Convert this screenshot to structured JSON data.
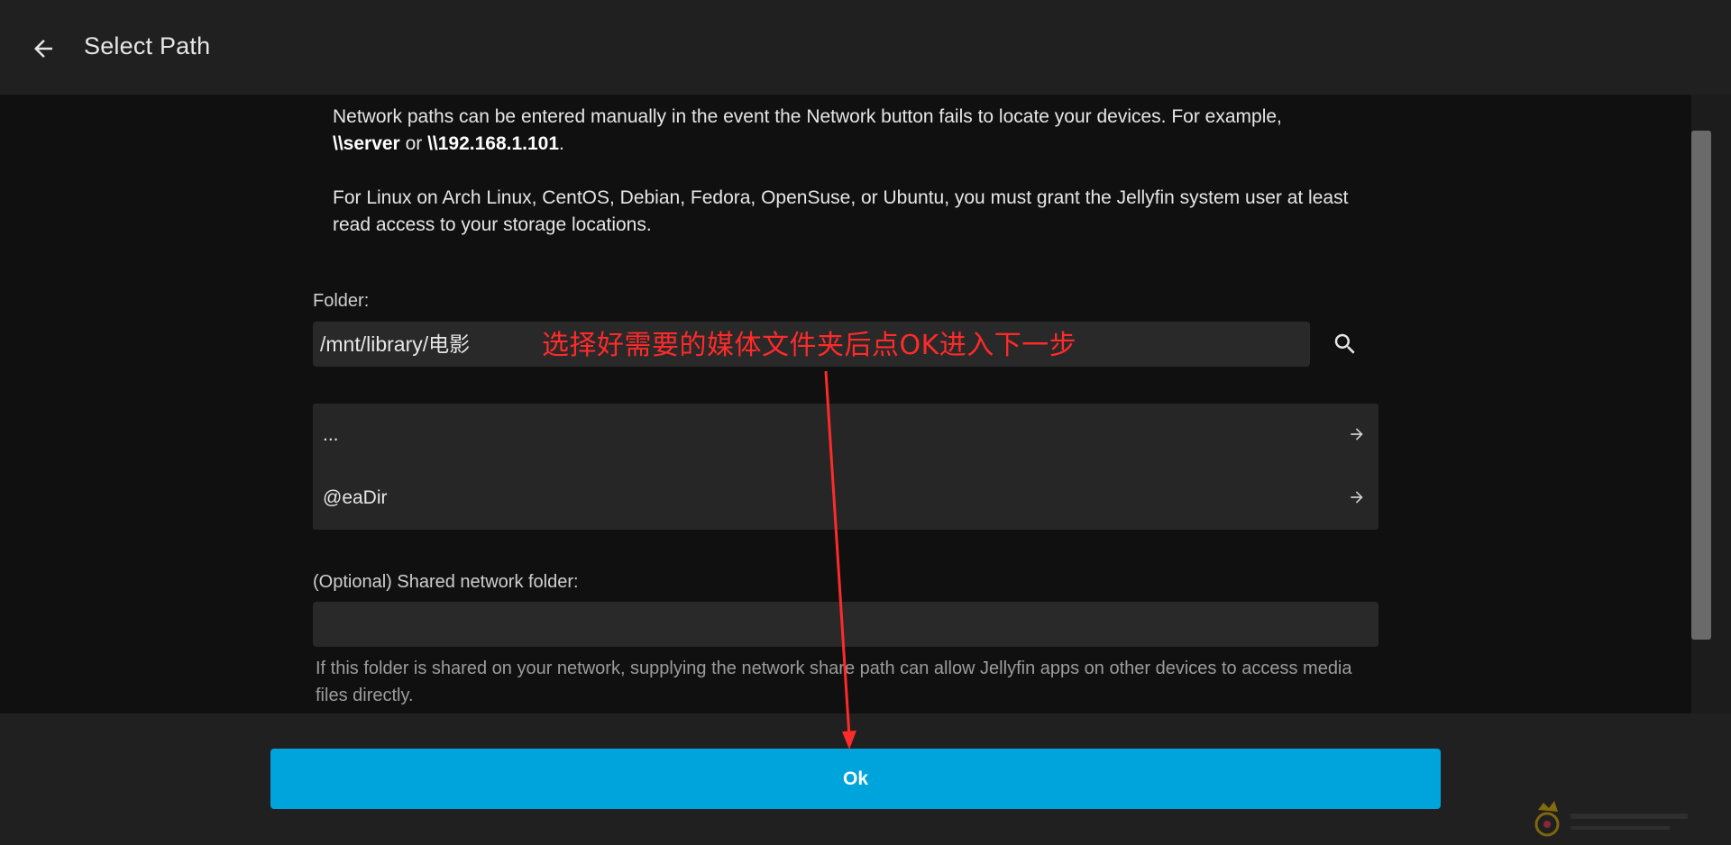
{
  "header": {
    "title": "Select Path"
  },
  "instructions": {
    "p1_before": "Network paths can be entered manually in the event the Network button fails to locate your devices. For example, ",
    "p1_server": "\\\\server",
    "p1_or": " or ",
    "p1_ip": "\\\\192.168.1.101",
    "p1_after": ".",
    "p2": "For Linux on Arch Linux, CentOS, Debian, Fedora, OpenSuse, or Ubuntu, you must grant the Jellyfin system user at least read access to your storage locations."
  },
  "folder": {
    "label": "Folder:",
    "value": "/mnt/library/电影"
  },
  "directories": [
    {
      "name": "..."
    },
    {
      "name": "@eaDir"
    }
  ],
  "shared_folder": {
    "label": "(Optional) Shared network folder:",
    "value": "",
    "help": "If this folder is shared on your network, supplying the network share path can allow Jellyfin apps on other devices to access media files directly."
  },
  "footer": {
    "ok_label": "Ok"
  },
  "annotation": {
    "text": "选择好需要的媒体文件夹后点OK进入下一步",
    "color": "#ff2a2a"
  },
  "colors": {
    "accent": "#00a4dc",
    "header_bg": "#202020",
    "page_bg": "#101010"
  },
  "icons": {
    "back": "arrow-back-icon",
    "search": "search-icon",
    "row_arrow": "arrow-forward-icon"
  }
}
